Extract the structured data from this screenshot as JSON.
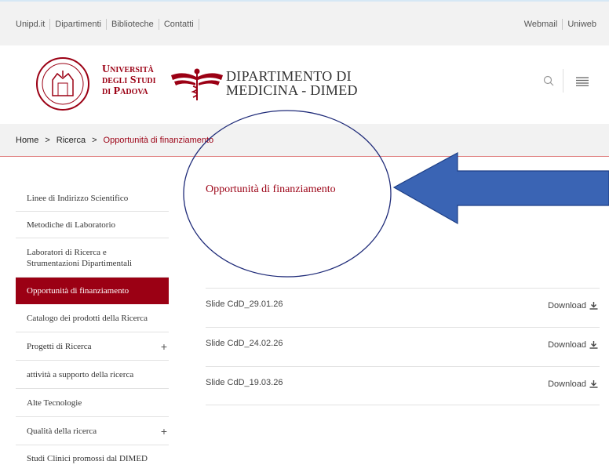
{
  "topbar": {
    "left_links": [
      "Unipd.it",
      "Dipartimenti",
      "Biblioteche",
      "Contatti"
    ],
    "right_links": [
      "Webmail",
      "Uniweb"
    ]
  },
  "header": {
    "university_lines": [
      "Università",
      "degli Studi",
      "di Padova"
    ],
    "department_lines": [
      "DIPARTIMENTO DI",
      "MEDICINA - DIMED"
    ],
    "icons": [
      "university-seal",
      "caduceus-logo",
      "search-icon",
      "menu-icon"
    ]
  },
  "breadcrumb": {
    "home": "Home",
    "sep": ">",
    "level1": "Ricerca",
    "current": "Opportunità di finanziamento"
  },
  "sidebar": {
    "items": [
      {
        "label": "Linee di Indirizzo Scientifico",
        "plus": ""
      },
      {
        "label": "Metodiche di Laboratorio",
        "plus": ""
      },
      {
        "label": "Laboratori di Ricerca e Strumentazioni Dipartimentali",
        "plus": ""
      },
      {
        "label": "Opportunità di finanziamento",
        "plus": ""
      },
      {
        "label": "Catalogo dei prodotti della Ricerca",
        "plus": ""
      },
      {
        "label": "Progetti di Ricerca",
        "plus": "+"
      },
      {
        "label": "attività a supporto della ricerca",
        "plus": ""
      },
      {
        "label": "Alte Tecnologie",
        "plus": ""
      },
      {
        "label": "Qualità della ricerca",
        "plus": "+"
      },
      {
        "label": "Studi Clinici promossi dal DIMED",
        "plus": ""
      }
    ]
  },
  "main": {
    "heading": "Opportunità di finanziamento",
    "downloads": [
      {
        "name": "Slide CdD_29.01.26",
        "link": "Download"
      },
      {
        "name": "Slide CdD_24.02.26",
        "link": "Download"
      },
      {
        "name": "Slide CdD_19.03.26",
        "link": "Download"
      }
    ]
  },
  "colors": {
    "brand": "#9b0014",
    "annotation_arrow": "#3a64b4"
  }
}
